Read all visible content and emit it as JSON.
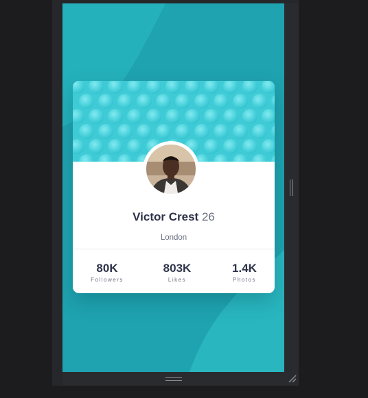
{
  "profile": {
    "name": "Victor Crest",
    "age": "26",
    "location": "London"
  },
  "stats": [
    {
      "value": "80K",
      "label": "Followers"
    },
    {
      "value": "803K",
      "label": "Likes"
    },
    {
      "value": "1.4K",
      "label": "Photos"
    }
  ],
  "colors": {
    "background": "#1fa3b0",
    "background_light": "#2bb7c0",
    "header_cyan": "#4fd6e0",
    "name_text": "#2e3349",
    "muted_text": "#6b7082"
  },
  "icons": {
    "resize_grip": "resize-grip-icon",
    "corner_resize": "corner-resize-icon"
  }
}
